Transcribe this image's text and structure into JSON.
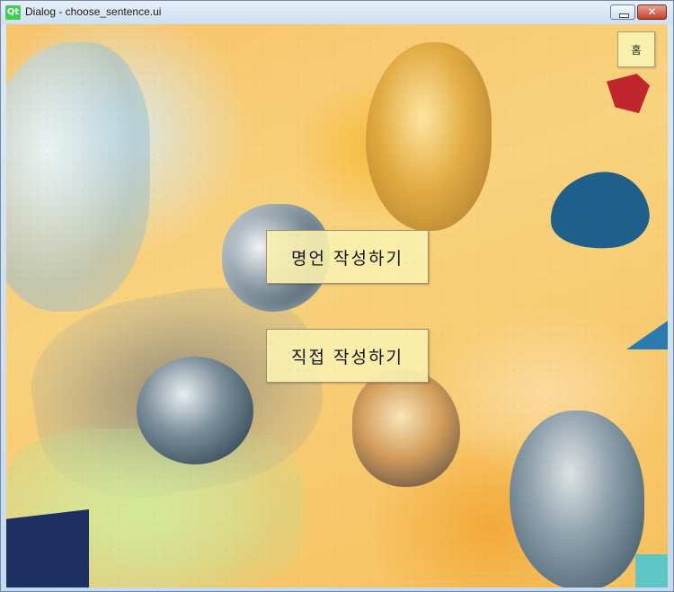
{
  "window": {
    "app_icon_label": "Qt",
    "title": "Dialog - choose_sentence.ui",
    "minimize_label": "",
    "close_label": ""
  },
  "dialog": {
    "home_button_label": "홈",
    "quote_button_label": "명언 작성하기",
    "direct_button_label": "직접 작성하기",
    "background": "abstract glass and liquid shapes wallpaper"
  },
  "colors": {
    "button_fill": "#faf1af",
    "accent_blue": "#1f5f8b",
    "accent_red": "#c0262c",
    "background_orange": "#f7c46a"
  }
}
